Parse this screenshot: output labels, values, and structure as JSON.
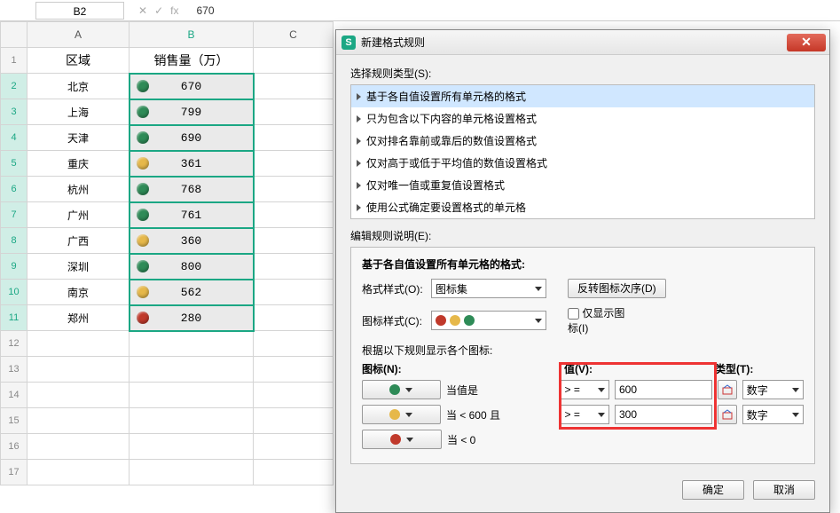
{
  "formula": {
    "cellRef": "B2",
    "fx": "fx",
    "value": "670"
  },
  "columns": [
    "A",
    "B",
    "C"
  ],
  "headers": {
    "A": "区域",
    "B": "销售量（万）"
  },
  "rows": [
    {
      "n": 1
    },
    {
      "n": 2,
      "a": "北京",
      "b": "670",
      "c": "green"
    },
    {
      "n": 3,
      "a": "上海",
      "b": "799",
      "c": "green"
    },
    {
      "n": 4,
      "a": "天津",
      "b": "690",
      "c": "green"
    },
    {
      "n": 5,
      "a": "重庆",
      "b": "361",
      "c": "yellow"
    },
    {
      "n": 6,
      "a": "杭州",
      "b": "768",
      "c": "green"
    },
    {
      "n": 7,
      "a": "广州",
      "b": "761",
      "c": "green"
    },
    {
      "n": 8,
      "a": "广西",
      "b": "360",
      "c": "yellow"
    },
    {
      "n": 9,
      "a": "深圳",
      "b": "800",
      "c": "green"
    },
    {
      "n": 10,
      "a": "南京",
      "b": "562",
      "c": "yellow"
    },
    {
      "n": 11,
      "a": "郑州",
      "b": "280",
      "c": "red"
    },
    {
      "n": 12
    },
    {
      "n": 13
    },
    {
      "n": 14
    },
    {
      "n": 15
    },
    {
      "n": 16
    },
    {
      "n": 17
    }
  ],
  "dialog": {
    "title": "新建格式规则",
    "ruleTypeLabel": "选择规则类型(S):",
    "ruleTypes": [
      "基于各自值设置所有单元格的格式",
      "只为包含以下内容的单元格设置格式",
      "仅对排名靠前或靠后的数值设置格式",
      "仅对高于或低于平均值的数值设置格式",
      "仅对唯一值或重复值设置格式",
      "使用公式确定要设置格式的单元格"
    ],
    "editDescLabel": "编辑规则说明(E):",
    "panelTitle": "基于各自值设置所有单元格的格式:",
    "styleLabel": "格式样式(O):",
    "styleValue": "图标集",
    "reverseBtn": "反转图标次序(D)",
    "iconLabel": "图标样式(C):",
    "onlyIconLabel": "仅显示图标(I)",
    "ruleDesc": "根据以下规则显示各个图标:",
    "hdrIcon": "图标(N):",
    "hdrValue": "值(V):",
    "hdrType": "类型(T):",
    "rules": [
      {
        "icon": "green",
        "cond": "当值是",
        "op": "> =",
        "val": "600",
        "type": "数字"
      },
      {
        "icon": "yellow",
        "cond": "当 < 600 且",
        "op": "> =",
        "val": "300",
        "type": "数字"
      },
      {
        "icon": "red",
        "cond": "当 < 0",
        "op": "",
        "val": "",
        "type": ""
      }
    ],
    "ok": "确定",
    "cancel": "取消"
  }
}
